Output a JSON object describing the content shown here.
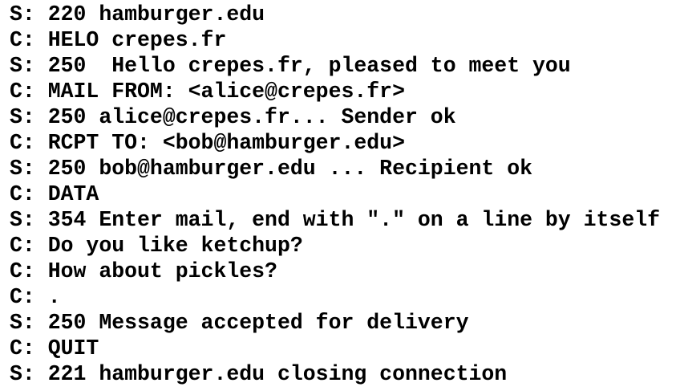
{
  "transcript": {
    "lines": [
      "S: 220 hamburger.edu",
      "C: HELO crepes.fr",
      "S: 250  Hello crepes.fr, pleased to meet you",
      "C: MAIL FROM: <alice@crepes.fr>",
      "S: 250 alice@crepes.fr... Sender ok",
      "C: RCPT TO: <bob@hamburger.edu>",
      "S: 250 bob@hamburger.edu ... Recipient ok",
      "C: DATA",
      "S: 354 Enter mail, end with \".\" on a line by itself",
      "C: Do you like ketchup?",
      "C: How about pickles?",
      "C: .",
      "S: 250 Message accepted for delivery",
      "C: QUIT",
      "S: 221 hamburger.edu closing connection"
    ]
  }
}
